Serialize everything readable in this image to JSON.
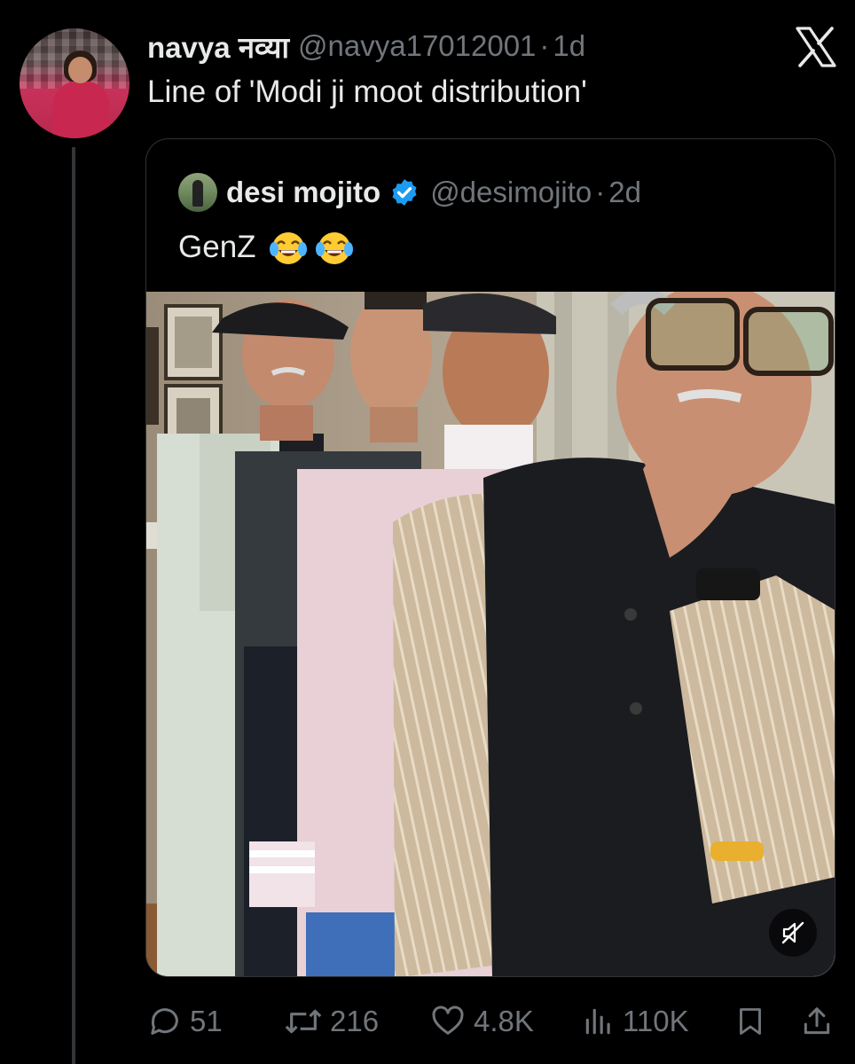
{
  "tweet": {
    "display_name": "navya नव्या",
    "handle": "@navya17012001",
    "separator": "·",
    "time": "1d",
    "text": "Line of 'Modi ji moot distribution'"
  },
  "quoted_tweet": {
    "display_name": "desi mojito",
    "handle": "@desimojito",
    "separator": "·",
    "time": "2d",
    "text": "GenZ",
    "emojis": [
      "face-with-tears-of-joy",
      "face-with-tears-of-joy"
    ],
    "verified": true
  },
  "actions": {
    "replies": "51",
    "reposts": "216",
    "likes": "4.8K",
    "views": "110K"
  },
  "colors": {
    "background": "#000000",
    "primary_text": "#e7e9ea",
    "secondary_text": "#71767b",
    "border": "#2f3336",
    "verified_blue": "#1d9bf0"
  }
}
